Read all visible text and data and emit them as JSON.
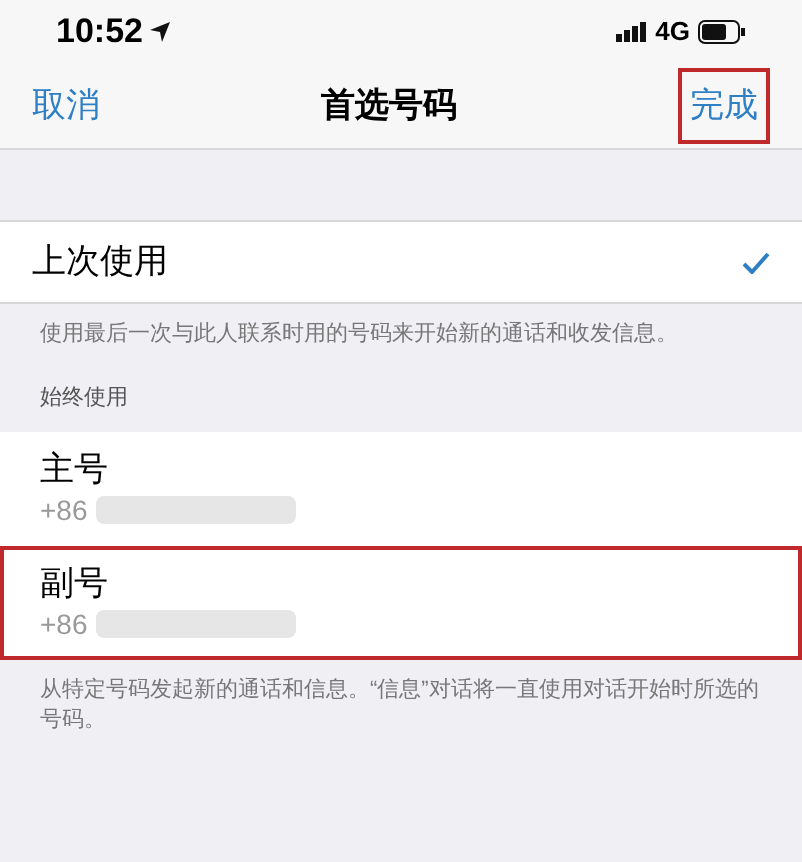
{
  "status_bar": {
    "time": "10:52",
    "network": "4G"
  },
  "nav": {
    "cancel": "取消",
    "title": "首选号码",
    "done": "完成",
    "done_highlighted": true
  },
  "last_used": {
    "label": "上次使用",
    "checked": true,
    "footer": "使用最后一次与此人联系时用的号码来开始新的通话和收发信息。"
  },
  "always_use": {
    "header": "始终使用",
    "options": [
      {
        "label": "主号",
        "number": "+86",
        "checked": false,
        "highlighted": false
      },
      {
        "label": "副号",
        "number": "+86",
        "checked": false,
        "highlighted": true
      }
    ],
    "footer": "从特定号码发起新的通话和信息。“信息”对话将一直使用对话开始时所选的号码。"
  }
}
